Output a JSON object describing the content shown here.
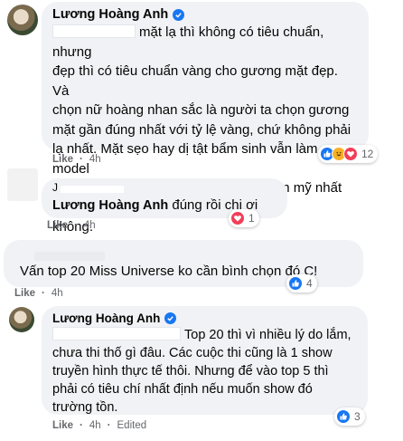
{
  "comments": [
    {
      "author": "Lương Hoàng Anh",
      "text_lines": [
        "mặt lạ thì không có tiêu chuẩn, nhưng",
        "đẹp thì có tiêu chuẩn vàng cho gương mặt đẹp. Và",
        "chọn nữ hoàng nhan sắc là người ta chọn gương",
        "mặt gần đúng nhất với tỷ lệ vàng, chứ không phải",
        "lạ nhất. Mặt sẹo hay dị tật bẩm sinh vẫn làm model",
        "được, nhưng đại diện cho cái đẹp hoàn mỹ nhất thì",
        "không."
      ],
      "like_label": "Like",
      "time": "4h",
      "reaction_count": "12"
    },
    {
      "author_prefix": "J",
      "mention": "Lương Hoàng Anh",
      "text": "đúng rồi chị ơi",
      "like_label": "Like",
      "time": "4h",
      "reaction_count": "1"
    },
    {
      "text": "Vấn top 20 Miss Universe ko cần bình chọn đó C!",
      "like_label": "Like",
      "time": "4h",
      "reaction_count": "4"
    },
    {
      "author": "Lương Hoàng Anh",
      "text_lines": [
        "Top 20 thì vì nhiều lý do lắm,",
        "chưa thi thố gì đâu. Các cuộc thi cũng là 1 show",
        "truyền hình thực tế thôi. Nhưng để vào top 5 thì",
        "phải có tiêu chí nhất định nếu muốn show đó",
        "trường tồn."
      ],
      "like_label": "Like",
      "time": "4h",
      "edited": "Edited",
      "reaction_count": "3"
    }
  ],
  "colors": {
    "bubble": "#f0f2f5",
    "meta": "#65676b",
    "like_blue": "#1877f2",
    "love_red": "#f33e58",
    "haha_yellow": "#f7b125"
  }
}
